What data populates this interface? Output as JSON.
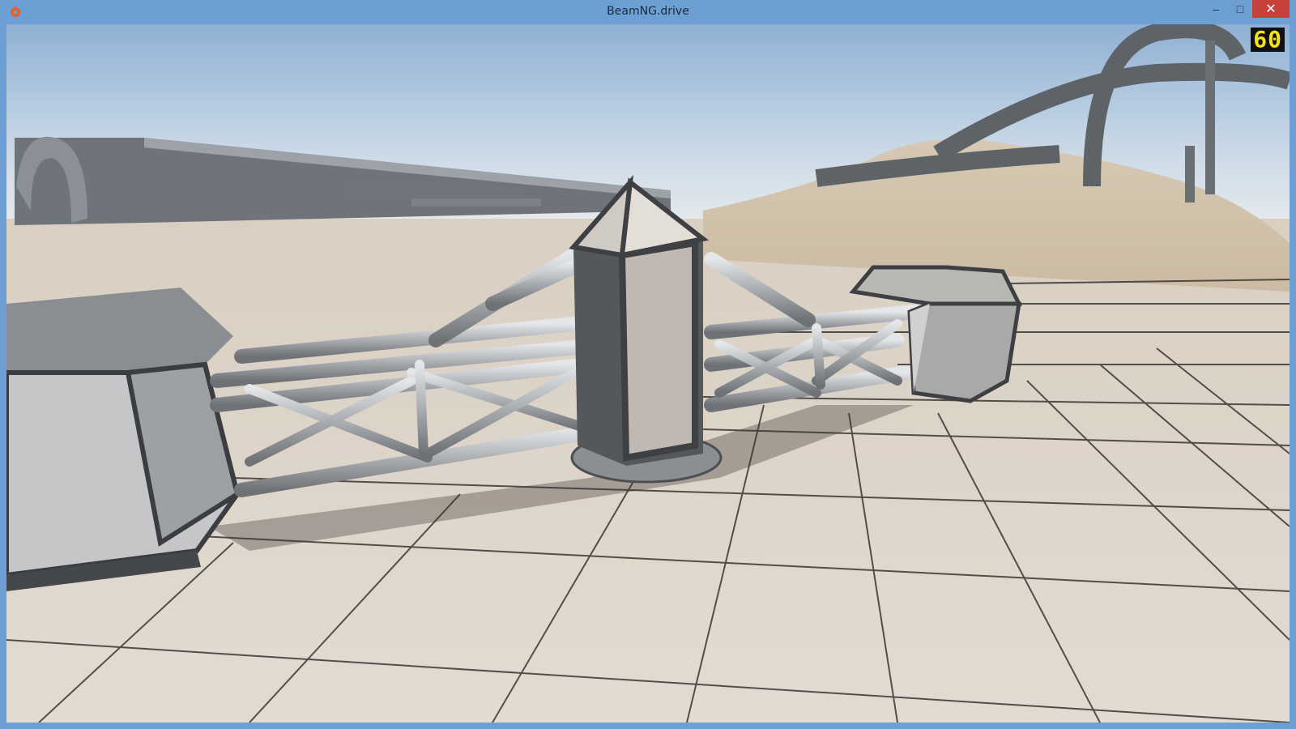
{
  "window": {
    "title": "BeamNG.drive",
    "minimize_icon": "minimize-icon",
    "maximize_icon": "maximize-icon",
    "close_icon": "close-icon",
    "minimize_glyph": "–",
    "maximize_glyph": "□",
    "close_glyph": "✕"
  },
  "hud": {
    "fps": "60"
  },
  "colors": {
    "titlebar": "#6d9fd4",
    "close": "#c7403a",
    "fps_text": "#f5e214",
    "sky_top": "#9fbbd9",
    "sky_bottom": "#dfe6ec",
    "ground": "#e0d6cc",
    "metal": "#b9bcbf"
  },
  "scene": {
    "description_icon": "game-viewport"
  }
}
